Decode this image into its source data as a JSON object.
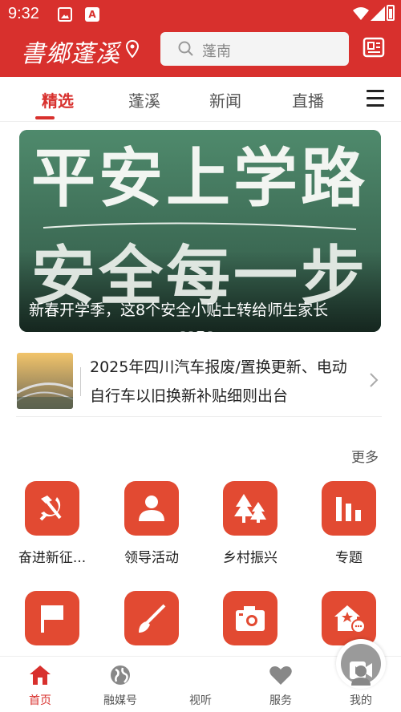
{
  "status_bar": {
    "time": "9:32"
  },
  "header": {
    "brand": "書鄉蓬溪",
    "search_placeholder": "蓬南"
  },
  "tabs": [
    "精选",
    "蓬溪",
    "新闻",
    "直播"
  ],
  "banner": {
    "big_text_line1": "平安上学路",
    "big_text_line2": "安全每一步",
    "caption": "新春开学季，这8个安全小贴士转给师生家长"
  },
  "news_item": {
    "title": "2025年四川汽车报废/置换更新、电动自行车以旧换新补贴细则出台"
  },
  "more_label": "更多",
  "services": [
    {
      "label": "奋进新征...",
      "icon": "hammer-sickle-icon"
    },
    {
      "label": "领导活动",
      "icon": "person-icon"
    },
    {
      "label": "乡村振兴",
      "icon": "trees-icon"
    },
    {
      "label": "专题",
      "icon": "bar-chart-icon"
    },
    {
      "label": "",
      "icon": "flag-icon"
    },
    {
      "label": "",
      "icon": "brush-icon"
    },
    {
      "label": "",
      "icon": "camera-icon"
    },
    {
      "label": "",
      "icon": "home-chat-icon"
    }
  ],
  "bottom_nav": [
    {
      "label": "首页",
      "icon": "home-icon"
    },
    {
      "label": "融媒号",
      "icon": "globe-icon"
    },
    {
      "label": "视听",
      "icon": "video-icon"
    },
    {
      "label": "服务",
      "icon": "heart-icon"
    },
    {
      "label": "我的",
      "icon": "user-icon"
    }
  ],
  "colors": {
    "brand_red": "#d8302d",
    "icon_red": "#e24a32"
  }
}
